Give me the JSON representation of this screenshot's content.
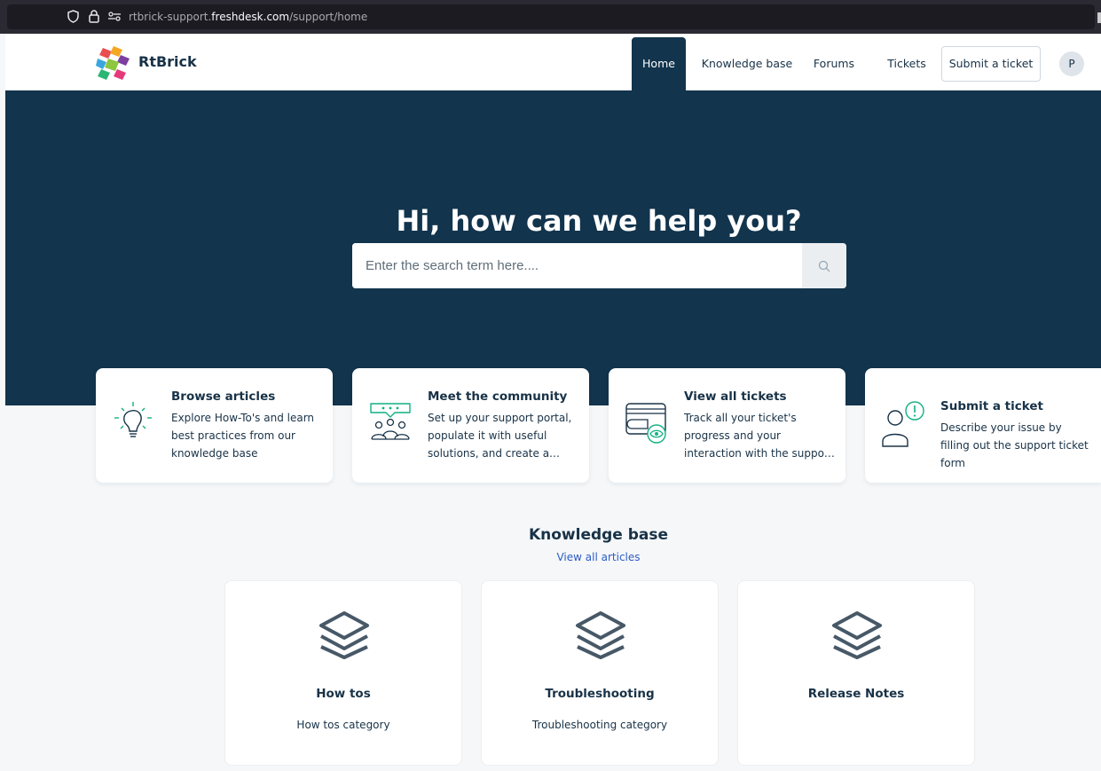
{
  "browser": {
    "url_prefix": "rtbrick-support.",
    "url_domain": "freshdesk.com",
    "url_path": "/support/home"
  },
  "header": {
    "brand": "RtBrick",
    "nav": [
      "Home",
      "Knowledge base",
      "Forums",
      "Tickets"
    ],
    "submit_label": "Submit a ticket",
    "avatar_initial": "P"
  },
  "hero": {
    "title": "Hi, how can we help you?",
    "search_placeholder": "Enter the search term here...."
  },
  "cards": [
    {
      "title": "Browse articles",
      "desc": "Explore How-To's and learn best practices from our knowledge base",
      "icon": "lightbulb-icon"
    },
    {
      "title": "Meet the community",
      "desc": "Set up your support portal, populate it with useful solutions, and create a…",
      "icon": "community-icon"
    },
    {
      "title": "View all tickets",
      "desc": "Track all your ticket's progress and your interaction with the suppo…",
      "icon": "tickets-icon"
    },
    {
      "title": "Submit a ticket",
      "desc": "Describe your issue by filling out the support ticket form",
      "icon": "user-alert-icon"
    }
  ],
  "knowledge_base": {
    "title": "Knowledge base",
    "view_all": "View all articles",
    "categories": [
      {
        "title": "How tos",
        "desc": "How tos category"
      },
      {
        "title": "Troubleshooting",
        "desc": "Troubleshooting category"
      },
      {
        "title": "Release Notes",
        "desc": ""
      }
    ]
  },
  "colors": {
    "primary": "#12344d",
    "accent": "#12b082",
    "link": "#2c5cc5",
    "background": "#f5f7f9"
  }
}
